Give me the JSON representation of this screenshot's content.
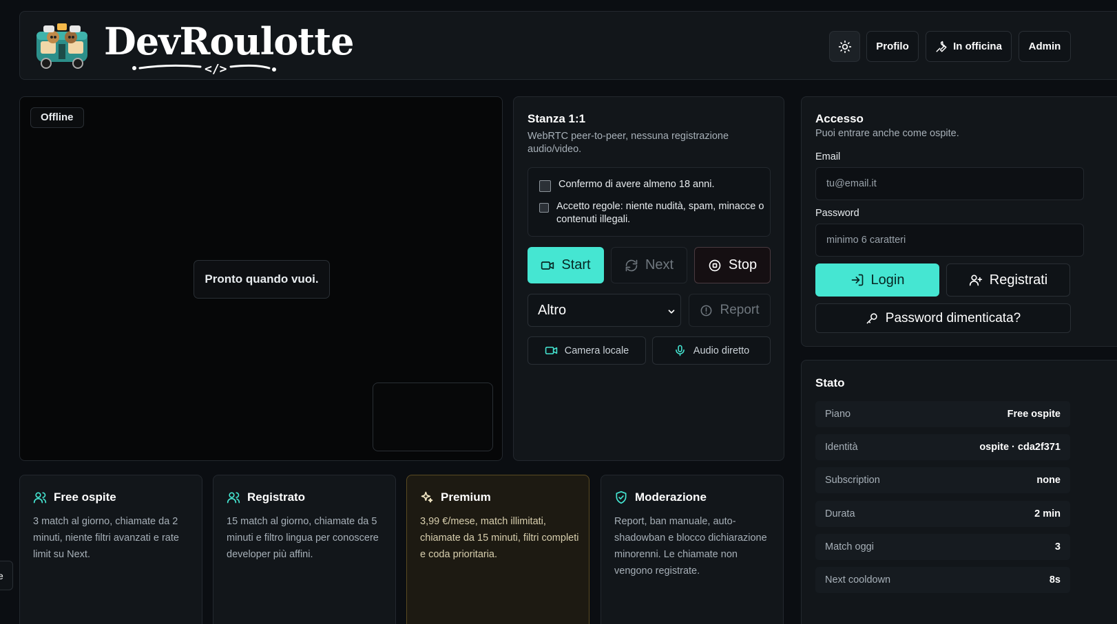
{
  "header": {
    "logo_text": "DevRoulotte",
    "logo_subtext": "</>",
    "theme_icon": "sun-icon",
    "nav": {
      "profilo": "Profilo",
      "officina": "In officina",
      "admin": "Admin"
    }
  },
  "video": {
    "status_badge": "Offline",
    "ready_message": "Pronto quando vuoi."
  },
  "room": {
    "title": "Stanza 1:1",
    "subtitle": "WebRTC peer-to-peer, nessuna registrazione audio/video.",
    "checks": {
      "age": "Confermo di avere almeno 18 anni.",
      "rules": "Accetto regole: niente nudità, spam, minacce o contenuti illegali."
    },
    "buttons": {
      "start": "Start",
      "next": "Next",
      "stop": "Stop",
      "report": "Report",
      "camera": "Camera locale",
      "audio": "Audio diretto"
    },
    "reason_select": "Altro"
  },
  "access": {
    "title": "Accesso",
    "subtitle": "Puoi entrare anche come ospite.",
    "email_label": "Email",
    "email_placeholder": "tu@email.it",
    "password_label": "Password",
    "password_placeholder": "minimo 6 caratteri",
    "login": "Login",
    "register": "Registrati",
    "forgot": "Password dimenticata?"
  },
  "stato": {
    "title": "Stato",
    "rows": [
      {
        "key": "Piano",
        "value": "Free ospite"
      },
      {
        "key": "Identità",
        "value": "ospite · cda2f371"
      },
      {
        "key": "Subscription",
        "value": "none"
      },
      {
        "key": "Durata",
        "value": "2 min"
      },
      {
        "key": "Match oggi",
        "value": "3"
      },
      {
        "key": "Next cooldown",
        "value": "8s"
      }
    ]
  },
  "plans": [
    {
      "title": "Free ospite",
      "icon": "users-icon",
      "text": "3 match al giorno, chiamate da 2 minuti, niente filtri avanzati e rate limit su Next."
    },
    {
      "title": "Registrato",
      "icon": "users-icon",
      "text": "15 match al giorno, chiamate da 5 minuti e filtro lingua per conoscere developer più affini."
    },
    {
      "title": "Premium",
      "icon": "sparkles-icon",
      "text": "3,99 €/mese, match illimitati, chiamate da 15 minuti, filtri completi e coda prioritaria."
    },
    {
      "title": "Moderazione",
      "icon": "shield-check-icon",
      "text": "Report, ban manuale, auto-shadowban e blocco dichiarazione minorenni. Le chiamate non vengono registrate."
    }
  ],
  "edge_tab": "e",
  "colors": {
    "accent": "#45e6d2",
    "background": "#0b0e12",
    "panel": "#12161a",
    "premium_border": "#5a4a22"
  }
}
